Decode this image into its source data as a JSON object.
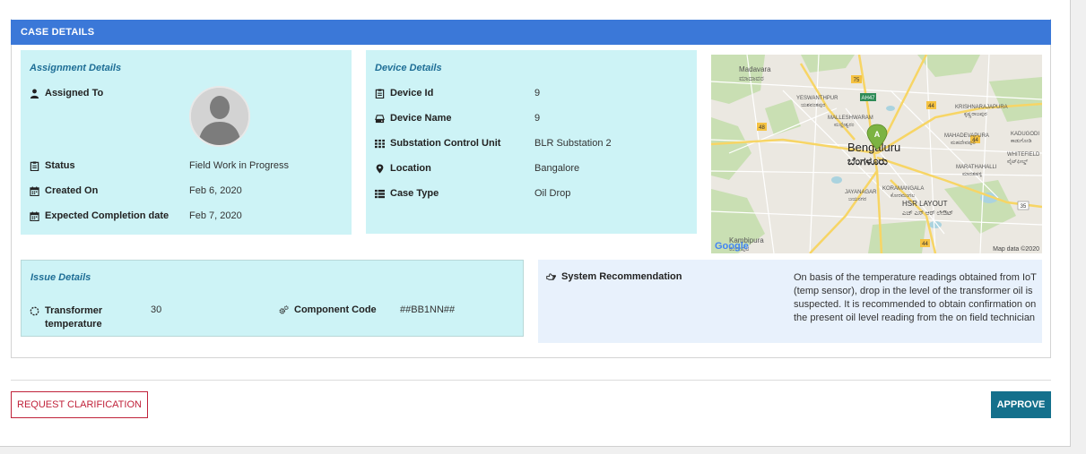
{
  "case_header": {
    "title": "CASE DETAILS"
  },
  "assignment": {
    "title": "Assignment Details",
    "assigned_to_label": "Assigned To",
    "status_label": "Status",
    "status_value": "Field Work in Progress",
    "created_on_label": "Created On",
    "created_on_value": "Feb 6, 2020",
    "expected_label": "Expected Completion date",
    "expected_value": "Feb 7, 2020"
  },
  "device": {
    "title": "Device Details",
    "device_id_label": "Device Id",
    "device_id_value": "9",
    "device_name_label": "Device Name",
    "device_name_value": "9",
    "substation_label": "Substation Control Unit",
    "substation_value": "BLR Substation 2",
    "location_label": "Location",
    "location_value": "Bangalore",
    "case_type_label": "Case Type",
    "case_type_value": "Oil Drop"
  },
  "map": {
    "marker_label": "A",
    "city_en": "Bengaluru",
    "city_kn": "ಬೆಂಗಳೂರು",
    "places": [
      {
        "id": "madavara",
        "en": "Madavara",
        "kn": "ಮಾದಾವರ"
      },
      {
        "id": "yeswanthpur",
        "en": "YESWANTHPUR",
        "kn": "ಯಶವಂತಪುರ"
      },
      {
        "id": "malleshwaram",
        "en": "MALLESHWARAM",
        "kn": "ಮಲ್ಲೇಶ್ವರಂ"
      },
      {
        "id": "krishnarajapura",
        "en": "KRISHNARAJAPURA",
        "kn": "ಕೃಷ್ಣರಾಜಪುರ"
      },
      {
        "id": "mahadevapura",
        "en": "MAHADEVAPURA",
        "kn": "ಮಹದೇವಪುರ"
      },
      {
        "id": "kadugodi",
        "en": "KADUGODI",
        "kn": "ಕಾಡುಗೋಡಿ"
      },
      {
        "id": "whitefield",
        "en": "WHITEFIELD",
        "kn": "ವೈಟ್‌ಫೀಲ್ಡ್"
      },
      {
        "id": "marathahalli",
        "en": "MARATHAHALLI",
        "kn": "ಮಾರತಹಳ್ಳಿ"
      },
      {
        "id": "koramangala",
        "en": "KORAMANGALA",
        "kn": "ಕೋರಮಂಗಲ"
      },
      {
        "id": "jayanagar",
        "en": "JAYANAGAR",
        "kn": "ಜಯನಗರ"
      },
      {
        "id": "hsr",
        "en": "HSR LAYOUT",
        "kn": "ಎಚ್ ಎಸ್ ಆರ್ ಲೇಔಟ್"
      },
      {
        "id": "kambipura",
        "en": "Kambipura",
        "kn": "ಕಂಬೀಪುರ"
      }
    ],
    "road_badges": [
      "75",
      "AH47",
      "44",
      "48",
      "44",
      "35",
      "44"
    ],
    "google_label": "Google",
    "attribution": "Map data ©2020"
  },
  "issue": {
    "title": "Issue Details",
    "transformer_label": "Transformer temperature",
    "transformer_value": "30",
    "component_label": "Component Code",
    "component_value": "##BB1NN##"
  },
  "recommendation": {
    "label": "System Recommendation",
    "text": "On basis of the temperature readings obtained from IoT (temp sensor), drop in the level of the transformer oil is suspected. It is recommended to obtain confirmation on the present oil level reading from the on field technician"
  },
  "actions": {
    "clarify_label": "REQUEST CLARIFICATION",
    "approve_label": "APPROVE"
  }
}
